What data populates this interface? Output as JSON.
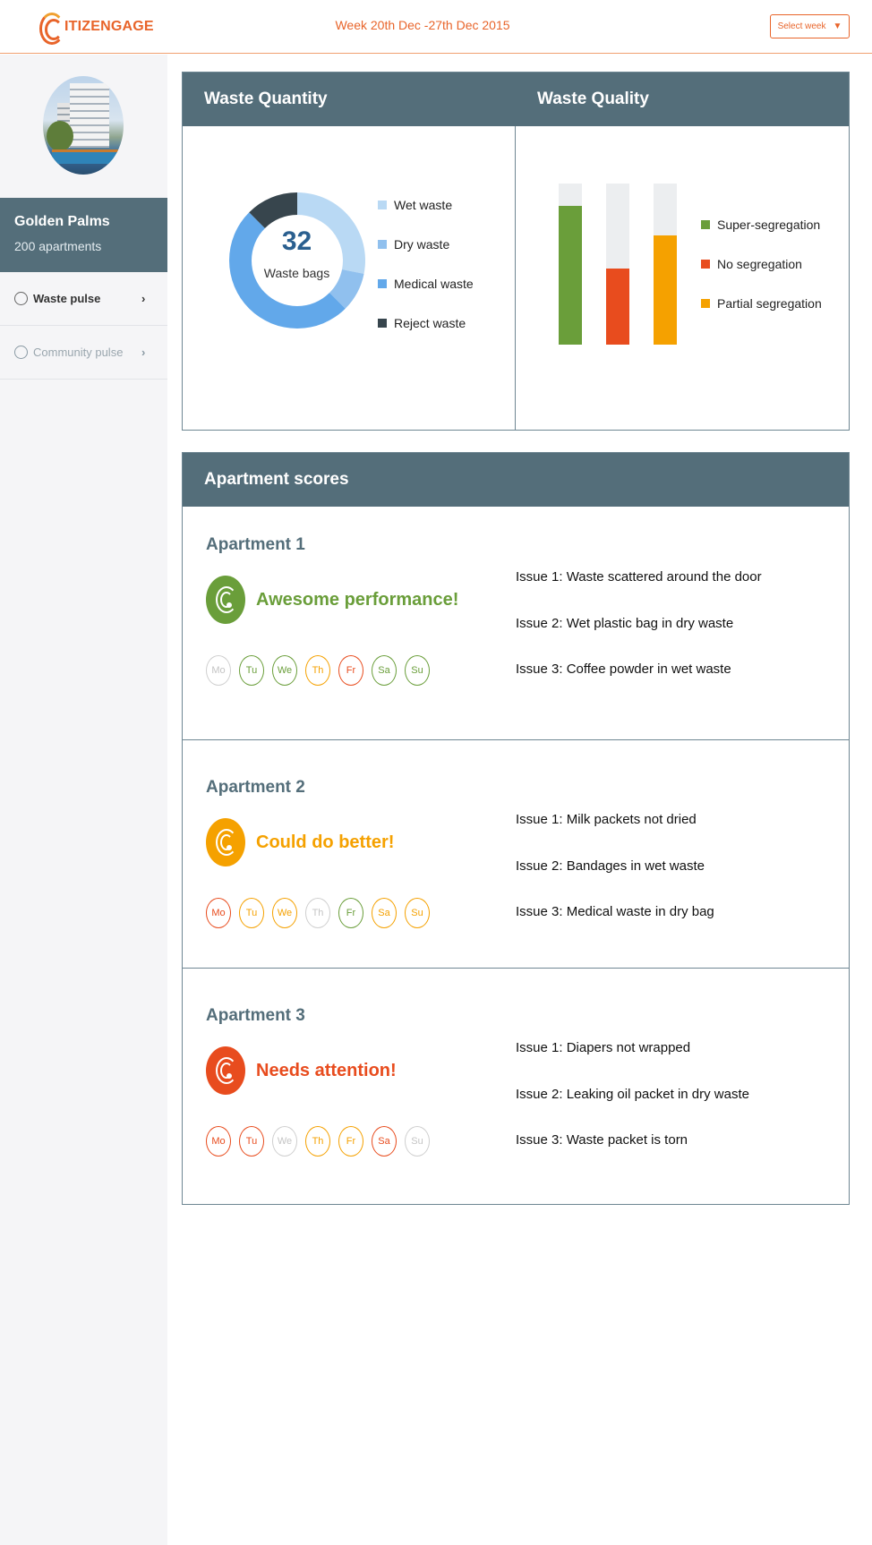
{
  "header": {
    "logo_text": "ITIZENGAGE",
    "week_title": "Week 20th Dec -27th Dec 2015",
    "select_week_label": "Select week",
    "caret": "▼"
  },
  "sidebar": {
    "property_name": "Golden Palms",
    "property_count": "200 apartments",
    "nav": [
      {
        "label": "Waste pulse",
        "active": true
      },
      {
        "label": "Community pulse",
        "active": false
      }
    ],
    "chevron": "›"
  },
  "waste_quantity": {
    "title": "Waste Quantity",
    "total": "32",
    "total_label": "Waste bags"
  },
  "waste_quality": {
    "title": "Waste Quality"
  },
  "chart_data": [
    {
      "type": "pie",
      "title": "Waste Quantity",
      "categories": [
        "Wet waste",
        "Dry waste",
        "Medical waste",
        "Reject waste"
      ],
      "values": [
        9,
        3,
        16,
        4
      ],
      "colors": [
        "#b9d9f4",
        "#90c0ee",
        "#62a8ea",
        "#37454d"
      ],
      "center_value": "32",
      "center_label": "Waste bags",
      "legend": "right"
    },
    {
      "type": "bar",
      "title": "Waste Quality",
      "categories": [
        "Super-segregation",
        "No segregation",
        "Partial segregation"
      ],
      "values": [
        86,
        47,
        68
      ],
      "ylim": [
        0,
        100
      ],
      "colors": [
        "#6a9e3a",
        "#e84c1e",
        "#f5a100"
      ],
      "track_color": "#eceef0",
      "legend": "right"
    }
  ],
  "scores": {
    "title": "Apartment scores",
    "apartments": [
      {
        "name": "Apartment 1",
        "status": "Awesome performance!",
        "status_color": "#6a9e3a",
        "days": [
          {
            "label": "Mo",
            "state": "grey"
          },
          {
            "label": "Tu",
            "state": "green"
          },
          {
            "label": "We",
            "state": "green"
          },
          {
            "label": "Th",
            "state": "orange"
          },
          {
            "label": "Fr",
            "state": "red"
          },
          {
            "label": "Sa",
            "state": "green"
          },
          {
            "label": "Su",
            "state": "green"
          }
        ],
        "issues": [
          "Issue 1:  Waste scattered around the door",
          "Issue 2:  Wet plastic bag in dry waste",
          "Issue 3:  Coffee powder in wet waste"
        ]
      },
      {
        "name": "Apartment 2",
        "status": "Could do better!",
        "status_color": "#f5a100",
        "days": [
          {
            "label": "Mo",
            "state": "red"
          },
          {
            "label": "Tu",
            "state": "orange"
          },
          {
            "label": "We",
            "state": "orange"
          },
          {
            "label": "Th",
            "state": "grey"
          },
          {
            "label": "Fr",
            "state": "green"
          },
          {
            "label": "Sa",
            "state": "orange"
          },
          {
            "label": "Su",
            "state": "orange"
          }
        ],
        "issues": [
          "Issue 1:  Milk packets not dried",
          "Issue 2:  Bandages in wet waste",
          "Issue 3:  Medical waste in dry bag"
        ]
      },
      {
        "name": "Apartment 3",
        "status": "Needs attention!",
        "status_color": "#e84c1e",
        "days": [
          {
            "label": "Mo",
            "state": "red"
          },
          {
            "label": "Tu",
            "state": "red"
          },
          {
            "label": "We",
            "state": "grey"
          },
          {
            "label": "Th",
            "state": "orange"
          },
          {
            "label": "Fr",
            "state": "orange"
          },
          {
            "label": "Sa",
            "state": "red"
          },
          {
            "label": "Su",
            "state": "grey"
          }
        ],
        "issues": [
          "Issue 1:  Diapers not wrapped",
          "Issue 2: Leaking oil packet in dry waste",
          "Issue 3:  Waste packet is torn"
        ]
      }
    ]
  },
  "colors": {
    "brand": "#e8642a",
    "header_slate": "#546e7a",
    "good": "#6a9e3a",
    "medium": "#f5a100",
    "bad": "#e84c1e"
  }
}
